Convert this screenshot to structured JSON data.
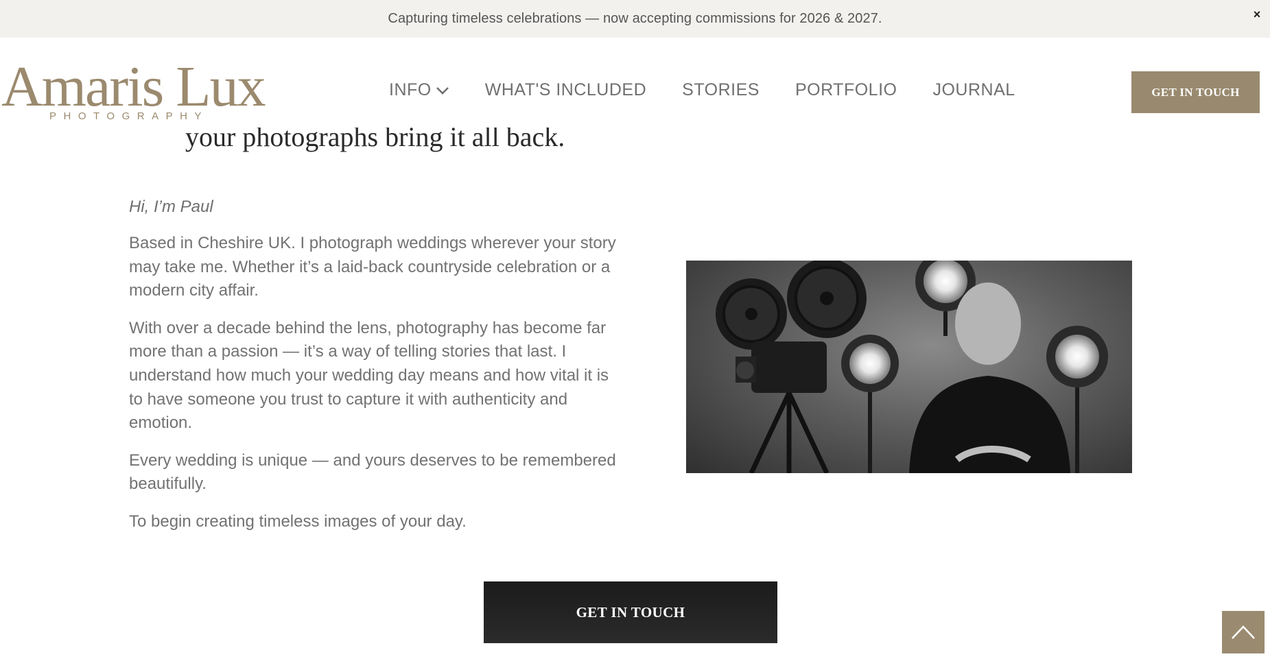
{
  "announcement": {
    "text": "Capturing timeless celebrations — now accepting commissions for 2026 & 2027.",
    "close_label": "×"
  },
  "brand": {
    "name": "Amaris Lux",
    "tagline": "PHOTOGRAPHY"
  },
  "nav": {
    "items": [
      {
        "label": "INFO",
        "has_dropdown": true
      },
      {
        "label": "WHAT'S INCLUDED"
      },
      {
        "label": "STORIES"
      },
      {
        "label": "PORTFOLIO"
      },
      {
        "label": "JOURNAL"
      }
    ],
    "cta_label": "GET IN TOUCH"
  },
  "hero": {
    "clipped_heading": "your photographs bring it all back."
  },
  "about": {
    "greeting": "Hi, I’m Paul",
    "paragraphs": [
      "Based in Cheshire UK. I photograph weddings wherever your story may take me. Whether it’s a laid-back countryside celebration or a modern city affair.",
      "With over a decade behind the lens, photography has become far more than a passion — it’s a way of telling stories that last. I understand how much your wedding day means and how vital it is to have someone you trust to capture it with authenticity and emotion.",
      "Every wedding is unique — and yours deserves to be remembered beautifully.",
      "To begin creating timeless images of your day."
    ]
  },
  "cta_bottom": {
    "label": "GET IN TOUCH"
  },
  "icons": {
    "dropdown": "chevron-down-icon",
    "back_to_top": "chevron-up-icon",
    "close": "close-icon"
  },
  "colors": {
    "brand_gold": "#998a6f",
    "announcement_bg": "#f2f1ee",
    "dark_button": "#1e1e1e"
  }
}
